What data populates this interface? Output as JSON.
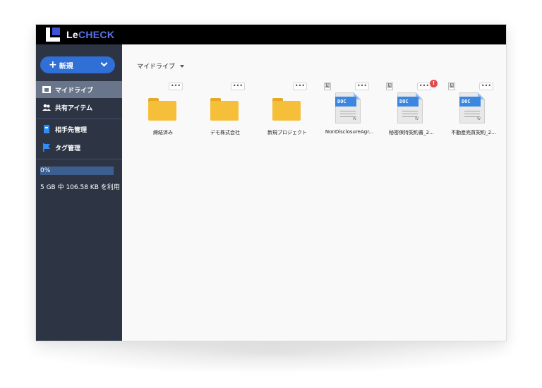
{
  "app": {
    "logo_text_le": "Le",
    "logo_text_check": "CHECK"
  },
  "sidebar": {
    "new_button": {
      "icon": "+",
      "label": "新規",
      "chevron_icon": "chevron-down-icon"
    },
    "items": [
      {
        "label": "マイドライブ",
        "icon": "drive-icon",
        "active": true
      },
      {
        "label": "共有アイテム",
        "icon": "people-icon"
      },
      {
        "label": "相手先管理",
        "icon": "address-book-icon"
      },
      {
        "label": "タグ管理",
        "icon": "flag-icon"
      }
    ],
    "storage": {
      "percent_text": "0%",
      "usage_text": "5 GB 中 106.58 KB を利用"
    }
  },
  "main": {
    "breadcrumb": "マイドライブ",
    "more_label": "•••",
    "files": [
      {
        "type": "folder",
        "name": "締結済み"
      },
      {
        "type": "folder",
        "name": "デモ株式会社"
      },
      {
        "type": "folder",
        "name": "新規プロジェクト"
      },
      {
        "type": "doc",
        "name": "NonDisclosureAgr...",
        "badge": "契",
        "doc_label": "DOC"
      },
      {
        "type": "doc",
        "name": "秘密保持契約書_2...",
        "badge": "契",
        "doc_label": "DOC",
        "alert": "!"
      },
      {
        "type": "doc",
        "name": "不動産売買契約_2...",
        "badge": "契",
        "doc_label": "DOC"
      }
    ]
  },
  "colors": {
    "sidebar": "#2d3545",
    "accent": "#2f6fd6",
    "folder": "#f6bf3a",
    "doc_blue": "#3a86e0",
    "alert": "#e5484d"
  }
}
